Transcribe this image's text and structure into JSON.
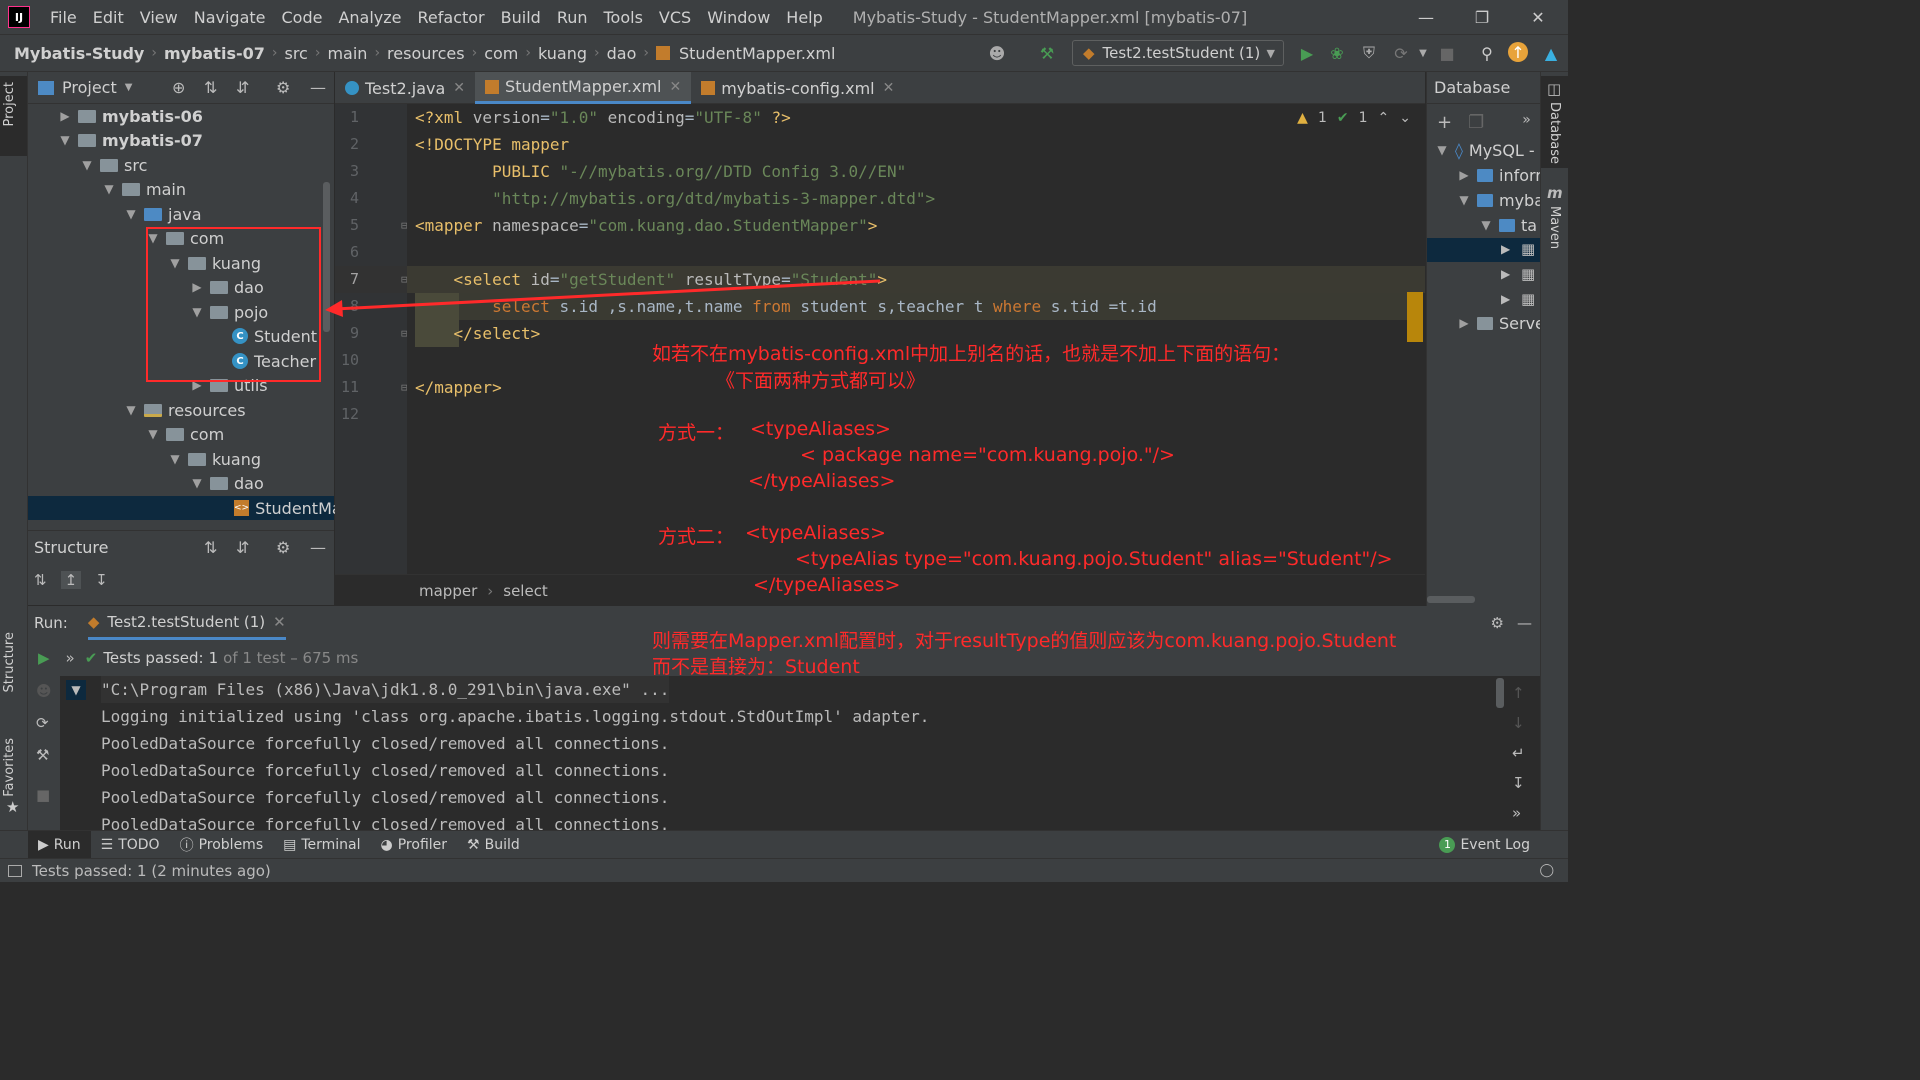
{
  "menubar": {
    "items": [
      "File",
      "Edit",
      "View",
      "Navigate",
      "Code",
      "Analyze",
      "Refactor",
      "Build",
      "Run",
      "Tools",
      "VCS",
      "Window",
      "Help"
    ],
    "window_title": "Mybatis-Study - StudentMapper.xml [mybatis-07]",
    "logo": "IJ"
  },
  "breadcrumbs": [
    "Mybatis-Study",
    "mybatis-07",
    "src",
    "main",
    "resources",
    "com",
    "kuang",
    "dao",
    "StudentMapper.xml"
  ],
  "run_config": "Test2.testStudent (1)",
  "project": {
    "title": "Project",
    "tree": [
      {
        "label": "mybatis-06",
        "bold": true
      },
      {
        "label": "mybatis-07",
        "bold": true
      },
      {
        "label": "src"
      },
      {
        "label": "main"
      },
      {
        "label": "java"
      },
      {
        "label": "com"
      },
      {
        "label": "kuang"
      },
      {
        "label": "dao"
      },
      {
        "label": "pojo"
      },
      {
        "label": "Student"
      },
      {
        "label": "Teacher"
      },
      {
        "label": "utils"
      },
      {
        "label": "resources"
      },
      {
        "label": "com"
      },
      {
        "label": "kuang"
      },
      {
        "label": "dao"
      },
      {
        "label": "StudentMa"
      }
    ]
  },
  "structure": {
    "title": "Structure"
  },
  "editor": {
    "tabs": [
      "Test2.java",
      "StudentMapper.xml",
      "mybatis-config.xml"
    ],
    "line_numbers": [
      "1",
      "2",
      "3",
      "4",
      "5",
      "6",
      "7",
      "8",
      "9",
      "10",
      "11",
      "12"
    ],
    "inspection": {
      "warnings": "1",
      "ok": "1"
    },
    "crumbs": [
      "mapper",
      "select"
    ],
    "code": {
      "l1_a": "<?xml ",
      "l1_b": "version",
      "l1_c": "=",
      "l1_d": "\"1.0\"",
      "l1_e": " encoding",
      "l1_f": "=",
      "l1_g": "\"UTF-8\"",
      "l1_h": " ?>",
      "l2": "<!DOCTYPE mapper",
      "l3_a": "        PUBLIC ",
      "l3_b": "\"-//mybatis.org//DTD Config 3.0//EN\"",
      "l4": "        \"http://mybatis.org/dtd/mybatis-3-mapper.dtd\">",
      "l5_a": "<mapper ",
      "l5_b": "namespace",
      "l5_c": "=",
      "l5_d": "\"com.kuang.dao.StudentMapper\"",
      "l5_e": ">",
      "l7_a": "    <select ",
      "l7_b": "id",
      "l7_c": "=",
      "l7_d": "\"getStudent\"",
      "l7_e": " resultType",
      "l7_f": "=",
      "l7_g": "\"Student\"",
      "l7_h": ">",
      "l8_a": "        select ",
      "l8_b": "s.id ,s.name,t.name ",
      "l8_c": "from ",
      "l8_d": "student s,teacher t ",
      "l8_e": "where ",
      "l8_f": "s.tid =t.id",
      "l9": "    </select>",
      "l11": "</mapper>"
    }
  },
  "annotations": {
    "line1": "如若不在mybatis-config.xml中加上别名的话，也就是不加上下面的语句：",
    "line2": "《下面两种方式都可以》",
    "way1_label": "方式一：",
    "way1_open": "<typeAliases>",
    "way1_pkg": "< package name=\"com.kuang.pojo.\"/>",
    "way1_close": "</typeAliases>",
    "way2_label": "方式二：",
    "way2_open": "<typeAliases>",
    "way2_alias": "<typeAlias type=\"com.kuang.pojo.Student\" alias=\"Student\"/>",
    "way2_close": "</typeAliases>",
    "conclusion1": "则需要在Mapper.xml配置时，对于resultType的值则应该为com.kuang.pojo.Student",
    "conclusion2": "而不是直接为：Student"
  },
  "database": {
    "title": "Database",
    "items": [
      "MySQL -",
      "inforr",
      "myba",
      "ta",
      "Serve"
    ]
  },
  "run": {
    "label": "Run:",
    "tab": "Test2.testStudent (1)",
    "tests_passed": "Tests passed:",
    "tests_count": "1",
    "tests_detail": "of 1 test – 675 ms",
    "console": [
      "\"C:\\Program Files (x86)\\Java\\jdk1.8.0_291\\bin\\java.exe\" ...",
      "Logging initialized using 'class org.apache.ibatis.logging.stdout.StdOutImpl' adapter.",
      "PooledDataSource forcefully closed/removed all connections.",
      "PooledDataSource forcefully closed/removed all connections.",
      "PooledDataSource forcefully closed/removed all connections.",
      "PooledDataSource forcefully closed/removed all connections."
    ]
  },
  "bottom_tools": [
    "Run",
    "TODO",
    "Problems",
    "Terminal",
    "Profiler",
    "Build"
  ],
  "event_log": {
    "label": "Event Log",
    "count": "1"
  },
  "side_tabs": {
    "project": "Project",
    "structure": "Structure",
    "favorites": "Favorites",
    "database": "Database",
    "maven": "Maven"
  },
  "status": "Tests passed: 1 (2 minutes ago)",
  "colors": {
    "accent": "#4a88c7",
    "annotation": "#ff2a2a",
    "pass": "#499c54"
  }
}
